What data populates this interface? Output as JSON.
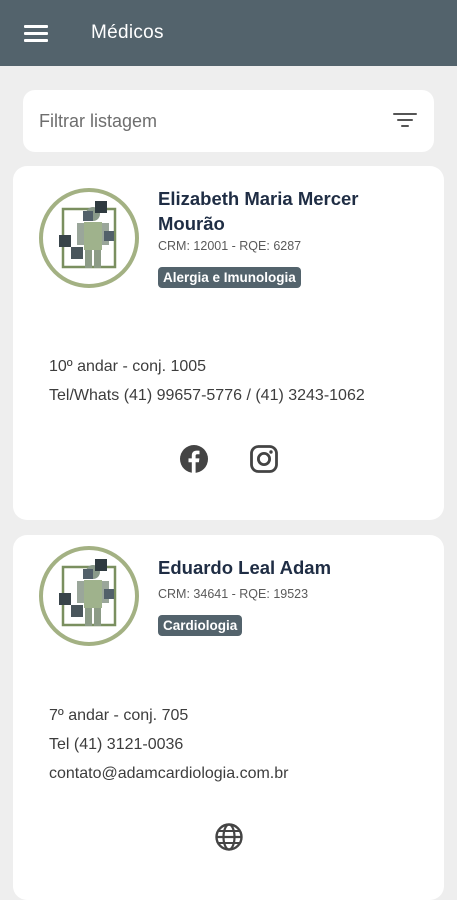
{
  "appbar": {
    "title": "Médicos",
    "menu_icon": "menu-icon"
  },
  "filter": {
    "placeholder": "Filtrar listagem",
    "icon": "filter-icon"
  },
  "colors": {
    "appbar": "#53636c",
    "badge": "#53636c",
    "avatar_ring": "#a3b183",
    "name": "#1f2d44"
  },
  "doctors": [
    {
      "name": "Elizabeth Maria Mercer Mourão",
      "credentials": "CRM: 12001 - RQE: 6287",
      "specialty": "Alergia e Imunologia",
      "address": "10º andar - conj. 1005",
      "phone": "Tel/Whats (41) 99657-5776 / (41) 3243-1062",
      "links": [
        "facebook-icon",
        "instagram-icon"
      ]
    },
    {
      "name": "Eduardo Leal Adam",
      "credentials": "CRM: 34641 - RQE: 19523",
      "specialty": "Cardiologia",
      "address": "7º andar - conj. 705",
      "phone": "Tel (41) 3121-0036",
      "email": "contato@adamcardiologia.com.br",
      "links": [
        "globe-icon"
      ]
    }
  ]
}
